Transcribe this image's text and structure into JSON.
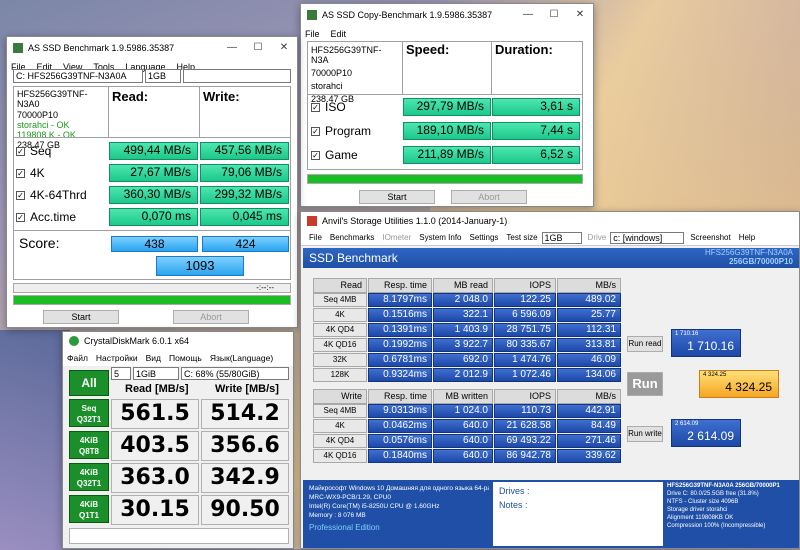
{
  "as_ssd": {
    "title": "AS SSD Benchmark 1.9.5986.35387",
    "menu": [
      "File",
      "Edit",
      "View",
      "Tools",
      "Language",
      "Help"
    ],
    "drive_select": "C: HFS256G39TNF-N3A0A",
    "size_select": "1GB",
    "info": [
      "HFS256G39TNF-N3A0",
      "70000P10",
      "storahci - OK",
      "119808 K - OK",
      "238.47 GB"
    ],
    "read_hdr": "Read:",
    "write_hdr": "Write:",
    "rows": [
      {
        "label": "Seq",
        "read": "499,44 MB/s",
        "write": "457,56 MB/s"
      },
      {
        "label": "4K",
        "read": "27,67 MB/s",
        "write": "79,06 MB/s"
      },
      {
        "label": "4K-64Thrd",
        "read": "360,30 MB/s",
        "write": "299,32 MB/s"
      },
      {
        "label": "Acc.time",
        "read": "0,070 ms",
        "write": "0,045 ms"
      }
    ],
    "score_label": "Score:",
    "score_read": "438",
    "score_write": "424",
    "score_total": "1093",
    "progress_text": "-:--:--",
    "progress": 1.0,
    "start": "Start",
    "abort": "Abort"
  },
  "copy": {
    "title": "AS SSD Copy-Benchmark 1.9.5986.35387",
    "menu": [
      "File",
      "Edit"
    ],
    "info": [
      "HFS256G39TNF-N3A",
      "70000P10",
      "storahci",
      "238.47 GB"
    ],
    "speed_hdr": "Speed:",
    "dur_hdr": "Duration:",
    "rows": [
      {
        "label": "ISO",
        "speed": "297,79 MB/s",
        "dur": "3,61 s"
      },
      {
        "label": "Program",
        "speed": "189,10 MB/s",
        "dur": "7,44 s"
      },
      {
        "label": "Game",
        "speed": "211,89 MB/s",
        "dur": "6,52 s"
      }
    ],
    "progress": 1.0,
    "start": "Start",
    "abort": "Abort"
  },
  "cdm": {
    "title": "CrystalDiskMark 6.0.1 x64",
    "menu": [
      "Файл",
      "Настройки",
      "Вид",
      "Помощь",
      "Язык(Language)"
    ],
    "count": "5",
    "size": "1GiB",
    "drive": "C: 68% (55/80GiB)",
    "all": "All",
    "read_hdr": "Read [MB/s]",
    "write_hdr": "Write [MB/s]",
    "rows": [
      {
        "l1": "Seq",
        "l2": "Q32T1",
        "read": "561.5",
        "write": "514.2"
      },
      {
        "l1": "4KiB",
        "l2": "Q8T8",
        "read": "403.5",
        "write": "356.6"
      },
      {
        "l1": "4KiB",
        "l2": "Q32T1",
        "read": "363.0",
        "write": "342.9"
      },
      {
        "l1": "4KiB",
        "l2": "Q1T1",
        "read": "30.15",
        "write": "90.50"
      }
    ]
  },
  "anvil": {
    "title": "Anvil's Storage Utilities 1.1.0 (2014-January-1)",
    "menu": [
      "File",
      "Benchmarks",
      "IOmeter",
      "System Info",
      "Settings",
      "Test size"
    ],
    "test_size": "1GB",
    "drive_lbl": "Drive",
    "drive_val": "c: [windows]",
    "screenshot": "Screenshot",
    "help": "Help",
    "banner": "SSD Benchmark",
    "model": "HFS256G39TNF-N3A0A",
    "model2": "256GB/70000P10",
    "read_cols": [
      "Read",
      "Resp. time",
      "MB read",
      "IOPS",
      "MB/s"
    ],
    "read_rows": [
      [
        "Seq 4MB",
        "8.1797ms",
        "2 048.0",
        "122.25",
        "489.02"
      ],
      [
        "4K",
        "0.1516ms",
        "322.1",
        "6 596.09",
        "25.77"
      ],
      [
        "4K QD4",
        "0.1391ms",
        "1 403.9",
        "28 751.75",
        "112.31"
      ],
      [
        "4K QD16",
        "0.1992ms",
        "3 922.7",
        "80 335.67",
        "313.81"
      ],
      [
        "32K",
        "0.6781ms",
        "692.0",
        "1 474.76",
        "46.09"
      ],
      [
        "128K",
        "0.9324ms",
        "2 012.9",
        "1 072.46",
        "134.06"
      ]
    ],
    "write_cols": [
      "Write",
      "Resp. time",
      "MB written",
      "IOPS",
      "MB/s"
    ],
    "write_rows": [
      [
        "Seq 4MB",
        "9.0313ms",
        "1 024.0",
        "110.73",
        "442.91"
      ],
      [
        "4K",
        "0.0462ms",
        "640.0",
        "21 628.58",
        "84.49"
      ],
      [
        "4K QD4",
        "0.0576ms",
        "640.0",
        "69 493.22",
        "271.46"
      ],
      [
        "4K QD16",
        "0.1840ms",
        "640.0",
        "86 942.78",
        "339.62"
      ]
    ],
    "run_read": "Run read",
    "read_score_small": "1 710.16",
    "read_score": "1 710.16",
    "run": "Run",
    "total_small": "4 324.25",
    "total": "4 324.25",
    "run_write": "Run write",
    "write_score_small": "2 614.09",
    "write_score": "2 614.09",
    "sys_lines": [
      "Майкрософт Windows 10 Домашняя для одного языка 64-ра",
      "MRC-WX9-PCB/1.29, CPU0",
      "Intel(R) Core(TM) i5-8250U CPU @ 1.60GHz",
      "Memory : 8 076 MB"
    ],
    "edition": "Professional Edition",
    "drives_lbl": "Drives :",
    "notes_lbl": "Notes :",
    "right_lines": [
      "HFS256G39TNF-N3A0A 256GB/70000P1",
      "Drive C: 80.0/25.5GB free (31.8%)",
      "NTFS - Cluster size 4096B",
      "Storage driver  storahci",
      "",
      "Alignment 119808KB OK",
      "Compression 100% (Incompressible)"
    ]
  }
}
